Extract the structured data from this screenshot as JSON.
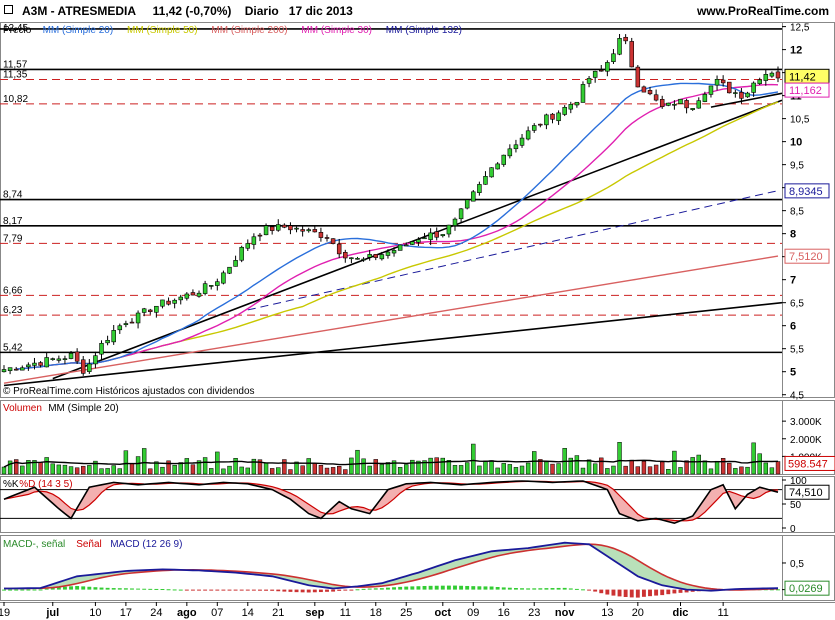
{
  "header": {
    "symbol": "A3M - ATRESMEDIA",
    "last": "11,42",
    "change": "(-0,70%)",
    "period": "Diario",
    "date": "17 dic 2013",
    "website": "www.ProRealTime.com"
  },
  "price_panel": {
    "legend": [
      {
        "label": "Precio",
        "color": "#000000"
      },
      {
        "label": "MM (Simple 20)",
        "color": "#2a6fdb"
      },
      {
        "label": "MM (Simple 50)",
        "color": "#c8c800"
      },
      {
        "label": "MM (Simple 200)",
        "color": "#d86060"
      },
      {
        "label": "MM (Simple 30)",
        "color": "#e020b0"
      },
      {
        "label": "MM (Simple 132)",
        "color": "#1a1a9a"
      }
    ],
    "copyright": "© ProRealTime.com  Históricos ajustados con dividendos",
    "top_label": "12,45",
    "y_ticks": [
      "12,5",
      "12",
      "11,5",
      "11",
      "10,5",
      "10",
      "9,5",
      "9",
      "8,5",
      "8",
      "7,5",
      "7",
      "6,5",
      "6",
      "5,5",
      "5",
      "4,5"
    ],
    "level_labels": [
      "11,57",
      "11,35",
      "10,82",
      "8,74",
      "8,17",
      "7,79",
      "6,66",
      "6,23",
      "5,42"
    ],
    "value_boxes": [
      {
        "text": "11,42",
        "color": "#000000",
        "bg": "#ffff66"
      },
      {
        "text": "11,162",
        "color": "#e020b0",
        "bg": "#ffffff"
      },
      {
        "text": "8,9345",
        "color": "#1a1a9a",
        "bg": "#ffffff"
      },
      {
        "text": "7,5120",
        "color": "#d86060",
        "bg": "#ffffff"
      }
    ]
  },
  "volume_panel": {
    "legend": [
      {
        "label": "Volumen",
        "color": "#cc0000"
      },
      {
        "label": "MM (Simple 20)",
        "color": "#000000"
      }
    ],
    "y_ticks": [
      "3.000K",
      "2.000K",
      "1.000K"
    ],
    "value_box": "598.547"
  },
  "stoch_panel": {
    "legend": [
      {
        "label": "%K",
        "color": "#000000"
      },
      {
        "label": "%D (14 3 5)",
        "color": "#cc0000"
      }
    ],
    "y_ticks": [
      "100",
      "50",
      "0"
    ],
    "value_box": "74,510"
  },
  "macd_panel": {
    "legend": [
      {
        "label": "MACD-, señal",
        "color": "#2a8a2a"
      },
      {
        "label": "Señal",
        "color": "#cc0000"
      },
      {
        "label": "MACD (12 26 9)",
        "color": "#1a1a9a"
      }
    ],
    "y_ticks": [
      "0,5",
      "0"
    ],
    "value_box": "0,0269"
  },
  "x_axis": {
    "labels": [
      "19",
      "jul",
      "10",
      "17",
      "24",
      "ago",
      "07",
      "14",
      "21",
      "sep",
      "11",
      "18",
      "25",
      "oct",
      "09",
      "16",
      "23",
      "nov",
      "13",
      "20",
      "dic",
      "11"
    ]
  },
  "chart_data": {
    "type": "candlestick",
    "title": "A3M - ATRESMEDIA",
    "period": "Diario",
    "x_start": "2013-06-19",
    "x_end": "2013-12-17",
    "ylim": [
      4.45,
      12.6
    ],
    "close_path": [
      [
        0,
        5.05
      ],
      [
        5,
        5.2
      ],
      [
        10,
        5.35
      ],
      [
        12,
        5.0
      ],
      [
        14,
        5.5
      ],
      [
        16,
        5.85
      ],
      [
        18,
        6.1
      ],
      [
        20,
        6.2
      ],
      [
        22,
        6.4
      ],
      [
        25,
        6.55
      ],
      [
        28,
        6.7
      ],
      [
        31,
        6.9
      ],
      [
        33,
        7.2
      ],
      [
        35,
        7.6
      ],
      [
        37,
        7.95
      ],
      [
        39,
        8.1
      ],
      [
        42,
        8.15
      ],
      [
        45,
        8.05
      ],
      [
        48,
        7.95
      ],
      [
        50,
        7.6
      ],
      [
        53,
        7.4
      ],
      [
        56,
        7.55
      ],
      [
        59,
        7.7
      ],
      [
        62,
        7.95
      ],
      [
        65,
        8.0
      ],
      [
        67,
        8.25
      ],
      [
        69,
        8.7
      ],
      [
        71,
        9.1
      ],
      [
        73,
        9.55
      ],
      [
        75,
        9.85
      ],
      [
        77,
        10.1
      ],
      [
        80,
        10.45
      ],
      [
        83,
        10.7
      ],
      [
        85,
        10.9
      ],
      [
        87,
        11.4
      ],
      [
        89,
        11.55
      ],
      [
        91,
        12.1
      ],
      [
        92,
        12.3
      ],
      [
        94,
        11.3
      ],
      [
        96,
        11.0
      ],
      [
        98,
        10.7
      ],
      [
        100,
        10.9
      ],
      [
        102,
        10.75
      ],
      [
        104,
        11.1
      ],
      [
        106,
        11.3
      ],
      [
        108,
        11.1
      ],
      [
        110,
        11.0
      ],
      [
        112,
        11.4
      ],
      [
        114,
        11.55
      ],
      [
        115,
        11.42
      ]
    ],
    "horizontal_levels": [
      12.45,
      11.57,
      11.35,
      10.82,
      8.74,
      8.17,
      7.79,
      6.66,
      6.23,
      5.42
    ],
    "moving_average_last": {
      "MM 30": 11.162,
      "MM 132": 8.9345,
      "MM 200": 7.512
    },
    "last_price": 11.42,
    "volume_ma_last": 598547,
    "stochastic_last": 74.51,
    "macd_last": 0.0269
  }
}
